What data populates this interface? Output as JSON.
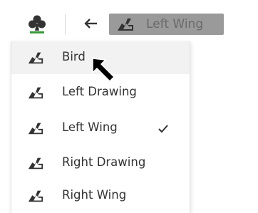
{
  "toolbar": {
    "club_icon": "club-icon",
    "back_icon": "back-arrow-icon",
    "selector": {
      "icon": "shape-template-icon",
      "selected": "Left Wing"
    }
  },
  "menu": {
    "items": [
      {
        "label": "Bird",
        "icon": "shape-template-icon",
        "hovered": true,
        "checked": false
      },
      {
        "label": "Left Drawing",
        "icon": "shape-template-icon",
        "hovered": false,
        "checked": false
      },
      {
        "label": "Left Wing",
        "icon": "shape-template-icon",
        "hovered": false,
        "checked": true
      },
      {
        "label": "Right Drawing",
        "icon": "shape-template-icon",
        "hovered": false,
        "checked": false
      },
      {
        "label": "Right Wing",
        "icon": "shape-template-icon",
        "hovered": false,
        "checked": false
      }
    ]
  },
  "colors": {
    "selector_bg": "#9a9a9a",
    "hover_bg": "#f2f2f2",
    "icon": "#333333",
    "club_green": "#3a9a3a"
  }
}
